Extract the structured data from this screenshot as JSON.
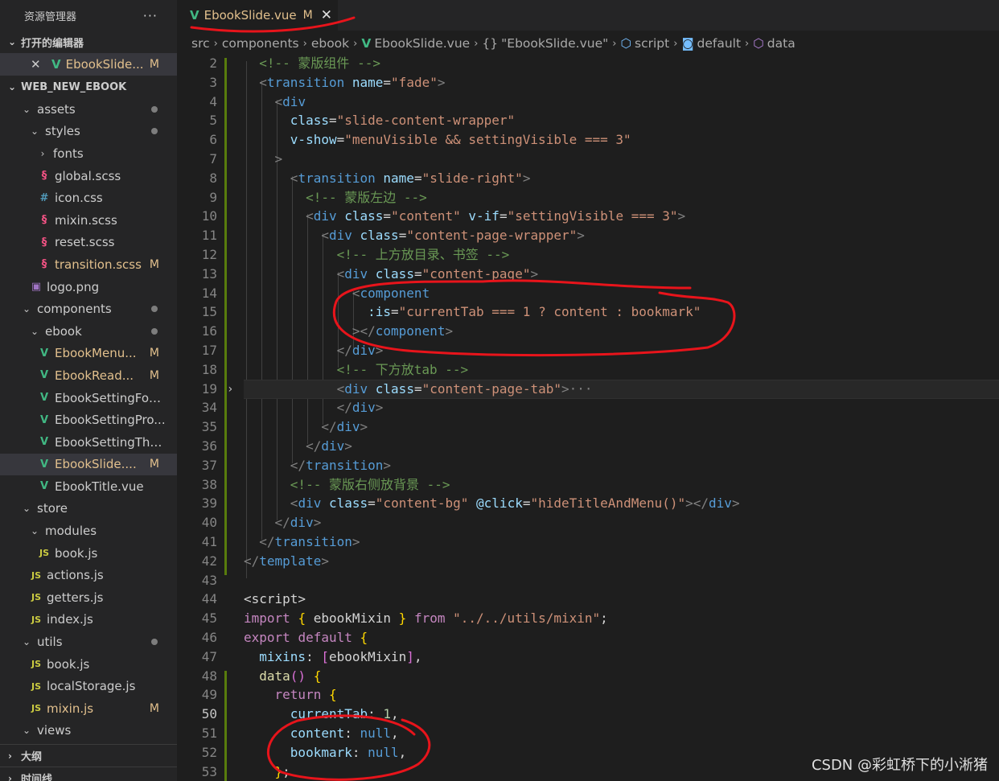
{
  "sidebar": {
    "title": "资源管理器",
    "more": "···",
    "open_editors": {
      "label": "打开的编辑器",
      "file": "EbookSlide...",
      "badge": "M"
    },
    "project": "WEB_NEW_EBOOK",
    "tree": [
      {
        "label": "assets",
        "type": "folder",
        "open": true,
        "dot": true
      },
      {
        "label": "styles",
        "type": "folder",
        "open": true,
        "dot": true
      },
      {
        "label": "fonts",
        "type": "folder",
        "open": false
      },
      {
        "label": "global.scss",
        "type": "scss"
      },
      {
        "label": "icon.css",
        "type": "css"
      },
      {
        "label": "mixin.scss",
        "type": "scss"
      },
      {
        "label": "reset.scss",
        "type": "scss"
      },
      {
        "label": "transition.scss",
        "type": "scss",
        "badge": "M"
      },
      {
        "label": "logo.png",
        "type": "png"
      },
      {
        "label": "components",
        "type": "folder",
        "open": true,
        "dot": true
      },
      {
        "label": "ebook",
        "type": "folder",
        "open": true,
        "dot": true
      },
      {
        "label": "EbookMenu...",
        "type": "vue",
        "badge": "M"
      },
      {
        "label": "EbookRead...",
        "type": "vue",
        "badge": "M"
      },
      {
        "label": "EbookSettingFont...",
        "type": "vue"
      },
      {
        "label": "EbookSettingPro...",
        "type": "vue"
      },
      {
        "label": "EbookSettingThe...",
        "type": "vue"
      },
      {
        "label": "EbookSlide....",
        "type": "vue",
        "badge": "M",
        "selected": true
      },
      {
        "label": "EbookTitle.vue",
        "type": "vue"
      },
      {
        "label": "store",
        "type": "folder",
        "open": true
      },
      {
        "label": "modules",
        "type": "folder",
        "open": true
      },
      {
        "label": "book.js",
        "type": "js"
      },
      {
        "label": "actions.js",
        "type": "js"
      },
      {
        "label": "getters.js",
        "type": "js"
      },
      {
        "label": "index.js",
        "type": "js"
      },
      {
        "label": "utils",
        "type": "folder",
        "open": true,
        "dot": true
      },
      {
        "label": "book.js",
        "type": "js"
      },
      {
        "label": "localStorage.js",
        "type": "js"
      },
      {
        "label": "mixin.js",
        "type": "js",
        "badge": "M"
      },
      {
        "label": "views",
        "type": "folder",
        "open": true
      }
    ],
    "outline": "大纲",
    "timeline": "时间线"
  },
  "tab": {
    "label": "EbookSlide.vue",
    "badge": "M",
    "close": "✕"
  },
  "breadcrumb": {
    "src": "src",
    "components": "components",
    "ebook": "ebook",
    "file": "EbookSlide.vue",
    "obj": "\"EbookSlide.vue\"",
    "script": "script",
    "default": "default",
    "data": "data"
  },
  "code_lines": [
    {
      "n": "2",
      "t": "    <!-- 蒙版组件 -->"
    },
    {
      "n": "3",
      "t": "    <transition name=\"fade\">"
    },
    {
      "n": "4",
      "t": "      <div"
    },
    {
      "n": "5",
      "t": "        class=\"slide-content-wrapper\""
    },
    {
      "n": "6",
      "t": "        v-show=\"menuVisible && settingVisible === 3\""
    },
    {
      "n": "7",
      "t": "      >"
    },
    {
      "n": "8",
      "t": "        <transition name=\"slide-right\">"
    },
    {
      "n": "9",
      "t": "          <!-- 蒙版左边 -->"
    },
    {
      "n": "10",
      "t": "          <div class=\"content\" v-if=\"settingVisible === 3\">"
    },
    {
      "n": "11",
      "t": "            <div class=\"content-page-wrapper\">"
    },
    {
      "n": "12",
      "t": "              <!-- 上方放目录、书签 -->"
    },
    {
      "n": "13",
      "t": "              <div class=\"content-page\">"
    },
    {
      "n": "14",
      "t": "                <component"
    },
    {
      "n": "15",
      "t": "                  :is=\"currentTab === 1 ? content : bookmark\""
    },
    {
      "n": "16",
      "t": "                ></component>"
    },
    {
      "n": "17",
      "t": "              </div>"
    },
    {
      "n": "18",
      "t": "              <!-- 下方放tab -->"
    },
    {
      "n": "19",
      "t": "              <div class=\"content-page-tab\">···"
    },
    {
      "n": "34",
      "t": "              </div>"
    },
    {
      "n": "35",
      "t": "            </div>"
    },
    {
      "n": "36",
      "t": "          </div>"
    },
    {
      "n": "37",
      "t": "        </transition>"
    },
    {
      "n": "38",
      "t": "        <!-- 蒙版右侧放背景 -->"
    },
    {
      "n": "39",
      "t": "        <div class=\"content-bg\" @click=\"hideTitleAndMenu()\"></div>"
    },
    {
      "n": "40",
      "t": "      </div>"
    },
    {
      "n": "41",
      "t": "    </transition>"
    },
    {
      "n": "42",
      "t": "  </template>"
    },
    {
      "n": "43",
      "t": ""
    },
    {
      "n": "44",
      "t": "  <script>"
    },
    {
      "n": "45",
      "t": "  import { ebookMixin } from \"../../utils/mixin\";"
    },
    {
      "n": "46",
      "t": "  export default {"
    },
    {
      "n": "47",
      "t": "    mixins: [ebookMixin],"
    },
    {
      "n": "48",
      "t": "    data() {"
    },
    {
      "n": "49",
      "t": "      return {"
    },
    {
      "n": "50",
      "t": "        currentTab: 1,"
    },
    {
      "n": "51",
      "t": "        content: null,"
    },
    {
      "n": "52",
      "t": "        bookmark: null,"
    },
    {
      "n": "53",
      "t": "      };"
    }
  ],
  "watermark": "CSDN @彩虹桥下的小淅猪",
  "colors": {
    "annotation": "#e8141b",
    "modified": "#e2c08d",
    "vue": "#41b883"
  }
}
